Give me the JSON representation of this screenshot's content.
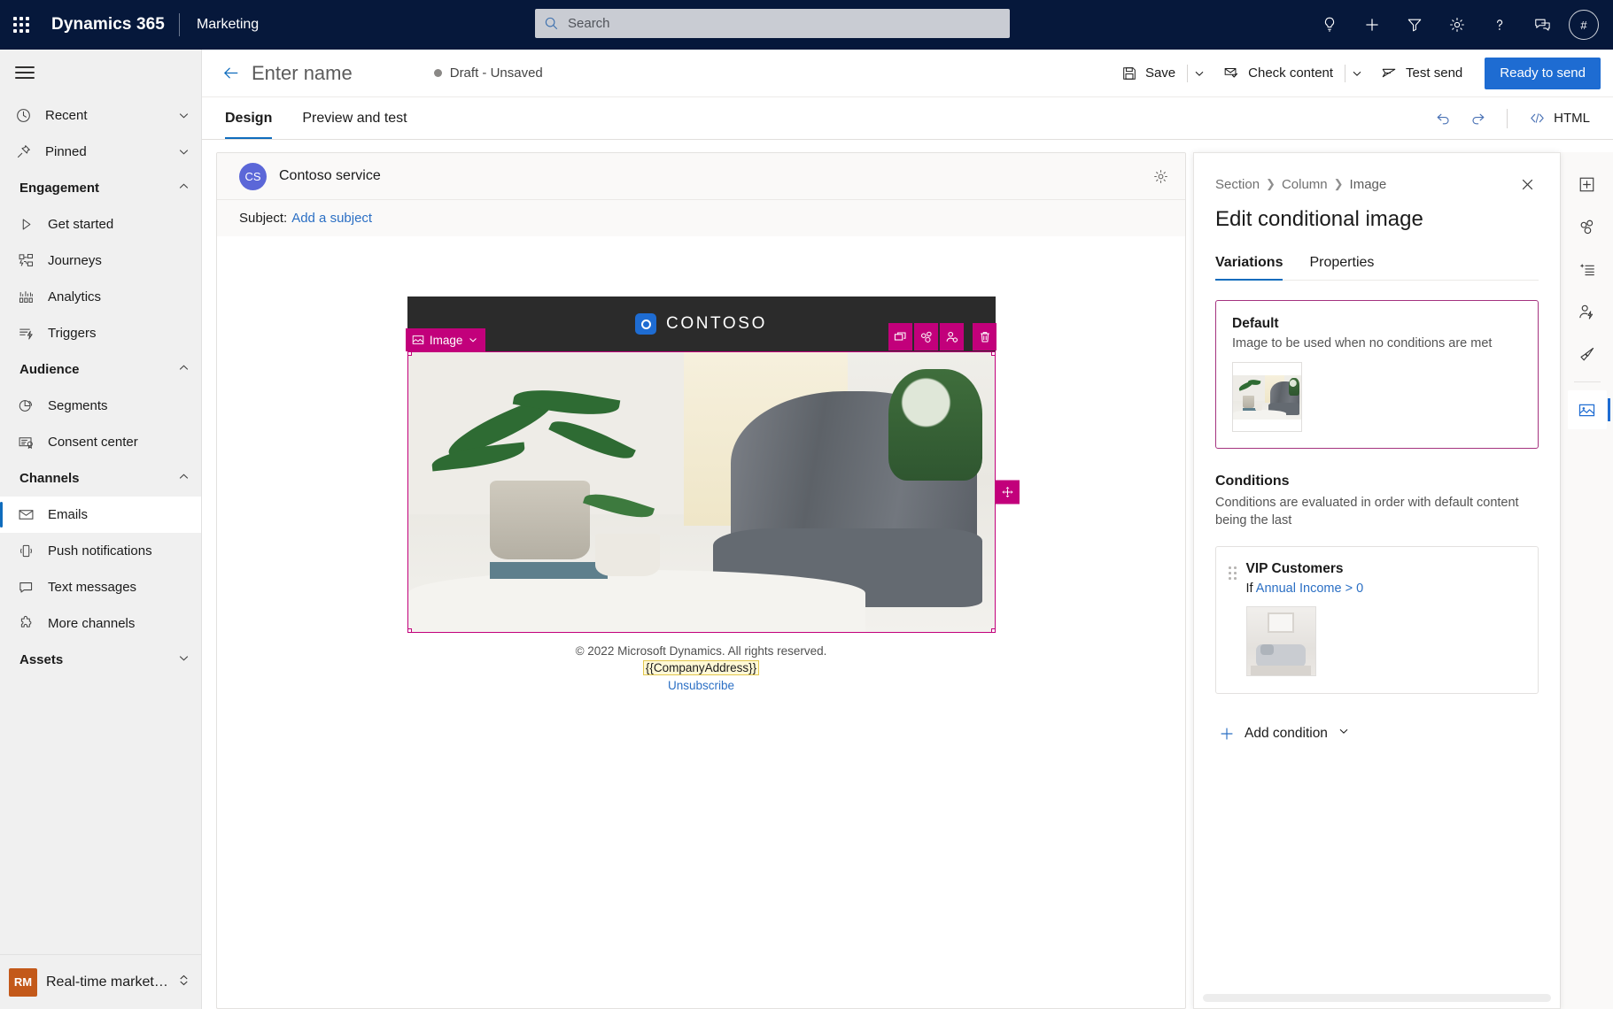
{
  "topnav": {
    "waffle_name": "app-launcher",
    "brand": "Dynamics 365",
    "app_name": "Marketing",
    "search_placeholder": "Search",
    "search_value": "",
    "icons": [
      {
        "name": "lightbulb-icon",
        "label": "Insights"
      },
      {
        "name": "plus-icon",
        "label": "New"
      },
      {
        "name": "filter-icon",
        "label": "Filter"
      },
      {
        "name": "gear-icon",
        "label": "Settings"
      },
      {
        "name": "help-icon",
        "label": "Help"
      },
      {
        "name": "feedback-icon",
        "label": "Feedback"
      }
    ],
    "avatar_initials": "#"
  },
  "sidebar": {
    "hamburger_name": "nav-collapse",
    "items": [
      {
        "label": "Recent",
        "icon": "clock-icon",
        "type": "expander",
        "chevron": "down"
      },
      {
        "label": "Pinned",
        "icon": "pin-icon",
        "type": "expander",
        "chevron": "down"
      },
      {
        "label": "Engagement",
        "type": "group",
        "chevron": "up"
      },
      {
        "label": "Get started",
        "icon": "play-icon",
        "type": "link"
      },
      {
        "label": "Journeys",
        "icon": "journeys-icon",
        "type": "link"
      },
      {
        "label": "Analytics",
        "icon": "analytics-icon",
        "type": "link"
      },
      {
        "label": "Triggers",
        "icon": "triggers-icon",
        "type": "link"
      },
      {
        "label": "Audience",
        "type": "group",
        "chevron": "up"
      },
      {
        "label": "Segments",
        "icon": "segments-icon",
        "type": "link"
      },
      {
        "label": "Consent center",
        "icon": "consent-icon",
        "type": "link"
      },
      {
        "label": "Channels",
        "type": "group",
        "chevron": "up"
      },
      {
        "label": "Emails",
        "icon": "mail-icon",
        "type": "link",
        "selected": true
      },
      {
        "label": "Push notifications",
        "icon": "push-icon",
        "type": "link"
      },
      {
        "label": "Text messages",
        "icon": "sms-icon",
        "type": "link"
      },
      {
        "label": "More channels",
        "icon": "puzzle-icon",
        "type": "link"
      },
      {
        "label": "Assets",
        "type": "group",
        "chevron": "down"
      }
    ],
    "footer": {
      "badge": "RM",
      "label": "Real-time marketi...",
      "chevron_name": "area-switcher-icon"
    }
  },
  "commandbar": {
    "back_name": "back-arrow-icon",
    "title": "Enter name",
    "status": "Draft - Unsaved",
    "save_label": "Save",
    "check_content_label": "Check content",
    "test_send_label": "Test send",
    "ready_to_send_label": "Ready to send"
  },
  "tabsbar": {
    "tabs": [
      {
        "label": "Design",
        "active": true
      },
      {
        "label": "Preview and test",
        "active": false
      }
    ],
    "undo_name": "undo-icon",
    "redo_name": "redo-icon",
    "html_label": "HTML"
  },
  "email": {
    "sender_initials": "CS",
    "sender_name": "Contoso service",
    "settings_icon": "gear-icon",
    "subject_label": "Subject:",
    "subject_link": "Add a subject",
    "brand_word": "CONTOSO",
    "selected_block": {
      "tag_label": "Image",
      "actions": [
        {
          "name": "duplicate-icon",
          "label": "Duplicate"
        },
        {
          "name": "variants-icon",
          "label": "Variants"
        },
        {
          "name": "personalize-icon",
          "label": "Personalize"
        },
        {
          "name": "delete-icon",
          "label": "Delete"
        }
      ],
      "move_handle_name": "move-handle-icon"
    },
    "footer": {
      "copyright": "© 2022 Microsoft Dynamics. All rights reserved.",
      "company_address_token": "{{CompanyAddress}}",
      "unsubscribe": "Unsubscribe"
    }
  },
  "rightpanel": {
    "breadcrumb": [
      "Section",
      "Column",
      "Image"
    ],
    "close_name": "close-icon",
    "title": "Edit conditional image",
    "tabs": [
      {
        "label": "Variations",
        "active": true
      },
      {
        "label": "Properties",
        "active": false
      }
    ],
    "default_card": {
      "title": "Default",
      "subtitle": "Image to be used when no conditions are met"
    },
    "conditions_section": {
      "title": "Conditions",
      "subtitle": "Conditions are evaluated in order with default content being the last",
      "items": [
        {
          "name": "VIP Customers",
          "if_prefix": "If",
          "attribute": "Annual Income",
          "operator": ">",
          "value": "0"
        }
      ]
    },
    "add_condition_label": "Add condition"
  },
  "iconrail": {
    "items": [
      {
        "name": "add-element-icon",
        "active": false
      },
      {
        "name": "elements-icon",
        "active": false
      },
      {
        "name": "templates-icon",
        "active": false
      },
      {
        "name": "personalization-icon",
        "active": false
      },
      {
        "name": "styles-brush-icon",
        "active": false
      },
      {
        "name": "image-icon",
        "active": true
      }
    ]
  },
  "colors": {
    "nav_bg": "#06183b",
    "accent_blue": "#1e6cd2",
    "link_blue": "#2b6fc4",
    "selection_magenta": "#c2007b",
    "variation_border": "#a4337f",
    "rm_orange": "#c3591a"
  }
}
